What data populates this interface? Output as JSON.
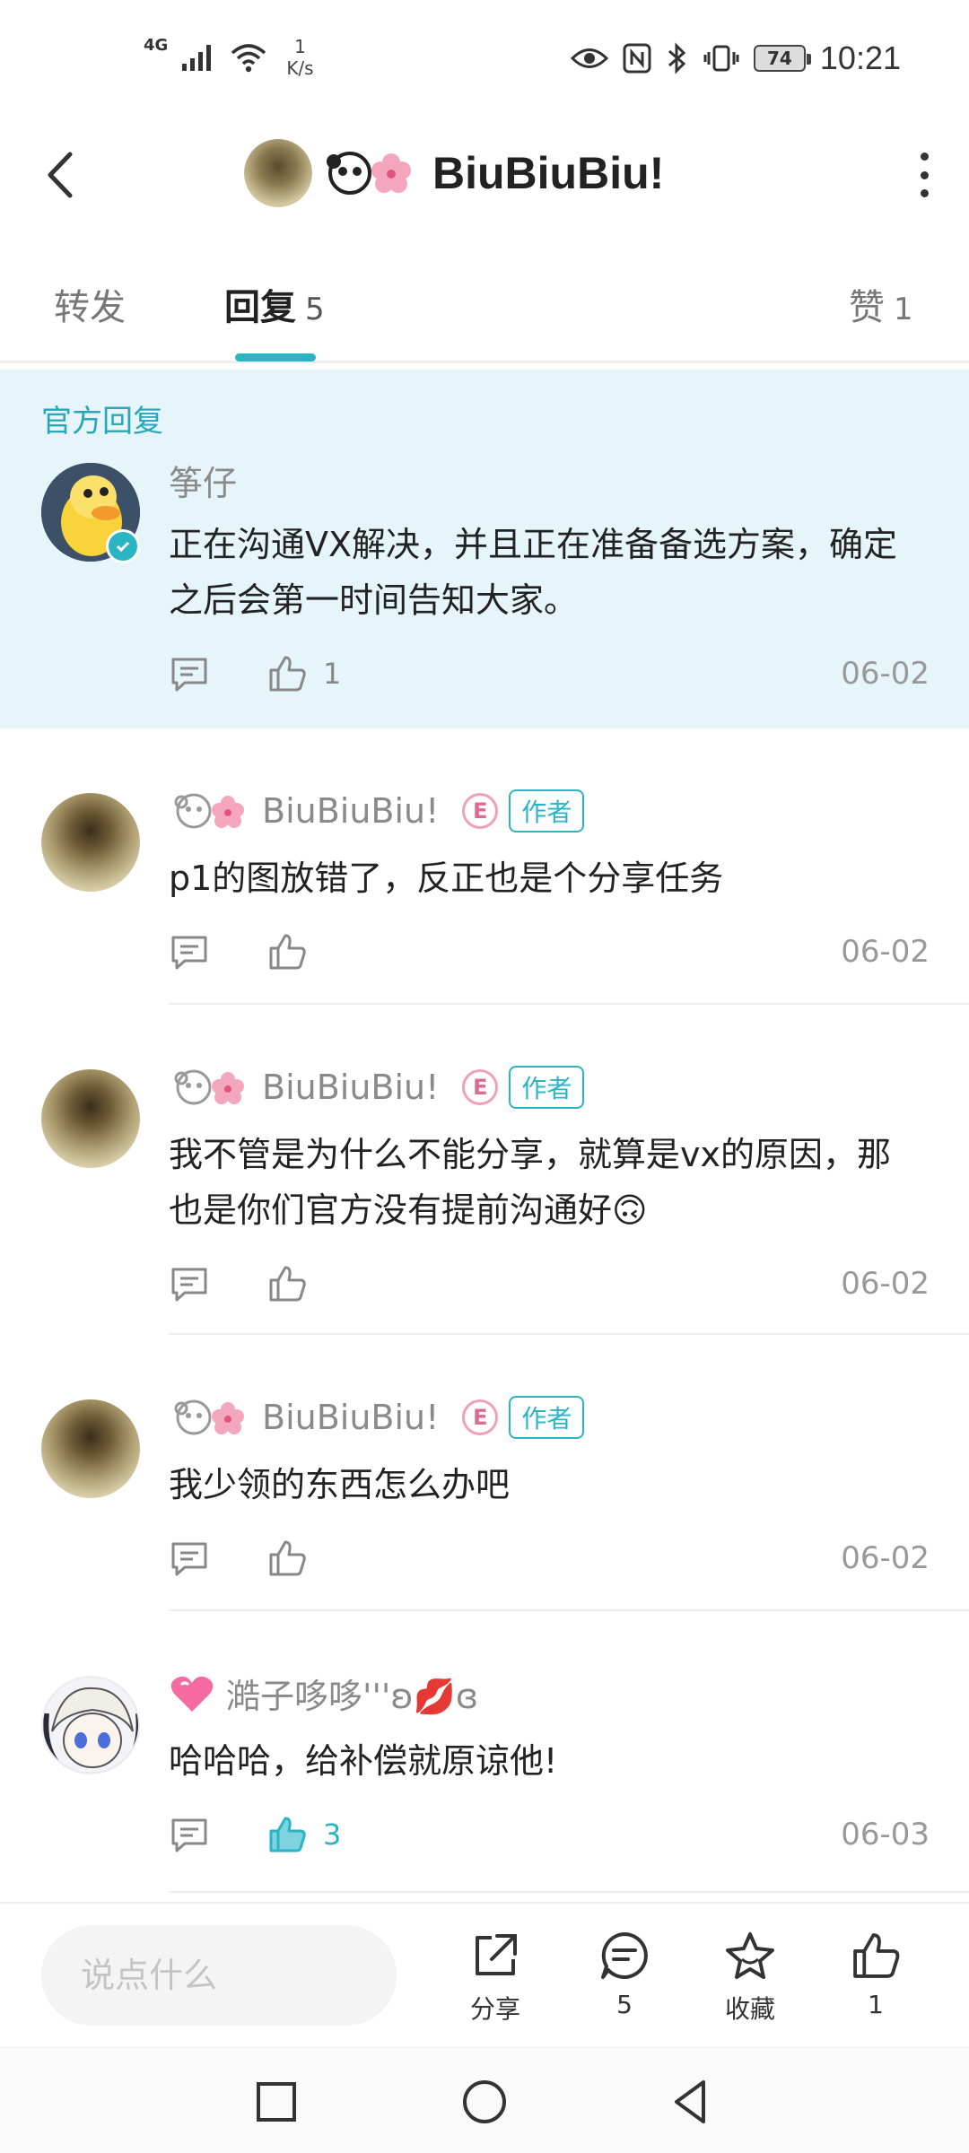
{
  "status_bar": {
    "network": "4G",
    "speed_value": "1",
    "speed_unit": "K/s",
    "battery": "74",
    "time": "10:21"
  },
  "header": {
    "title": "BiuBiuBiu!"
  },
  "tabs": [
    {
      "label": "转发",
      "count": ""
    },
    {
      "label": "回复",
      "count": "5"
    },
    {
      "label": "赞",
      "count": "1"
    }
  ],
  "official": {
    "label": "官方回复",
    "comment": {
      "name": "筝仔",
      "text": "正在沟通VX解决，并且正在准备备选方案，确定之后会第一时间告知大家。",
      "likes": "1",
      "date": "06-02"
    }
  },
  "comments": [
    {
      "name": "BiuBiuBiu!",
      "badge_letter": "E",
      "author_tag": "作者",
      "text": "p1的图放错了，反正也是个分享任务",
      "likes": "",
      "date": "06-02"
    },
    {
      "name": "BiuBiuBiu!",
      "badge_letter": "E",
      "author_tag": "作者",
      "text": "我不管是为什么不能分享，就算是vx的原因，那也是你们官方没有提前沟通好🙃",
      "likes": "",
      "date": "06-02"
    },
    {
      "name": "BiuBiuBiu!",
      "badge_letter": "E",
      "author_tag": "作者",
      "text": "我少领的东西怎么办吧",
      "likes": "",
      "date": "06-02"
    },
    {
      "name": "澔子哆哆'''ʚ💋ɞ",
      "text": "哈哈哈，给补偿就原谅他!",
      "likes": "3",
      "date": "06-03"
    }
  ],
  "bottom_bar": {
    "input_placeholder": "说点什么",
    "share_label": "分享",
    "comment_count": "5",
    "favorite_label": "收藏",
    "like_count": "1"
  },
  "colors": {
    "accent": "#2bb5c4",
    "official_bg": "#e5f5f9"
  }
}
